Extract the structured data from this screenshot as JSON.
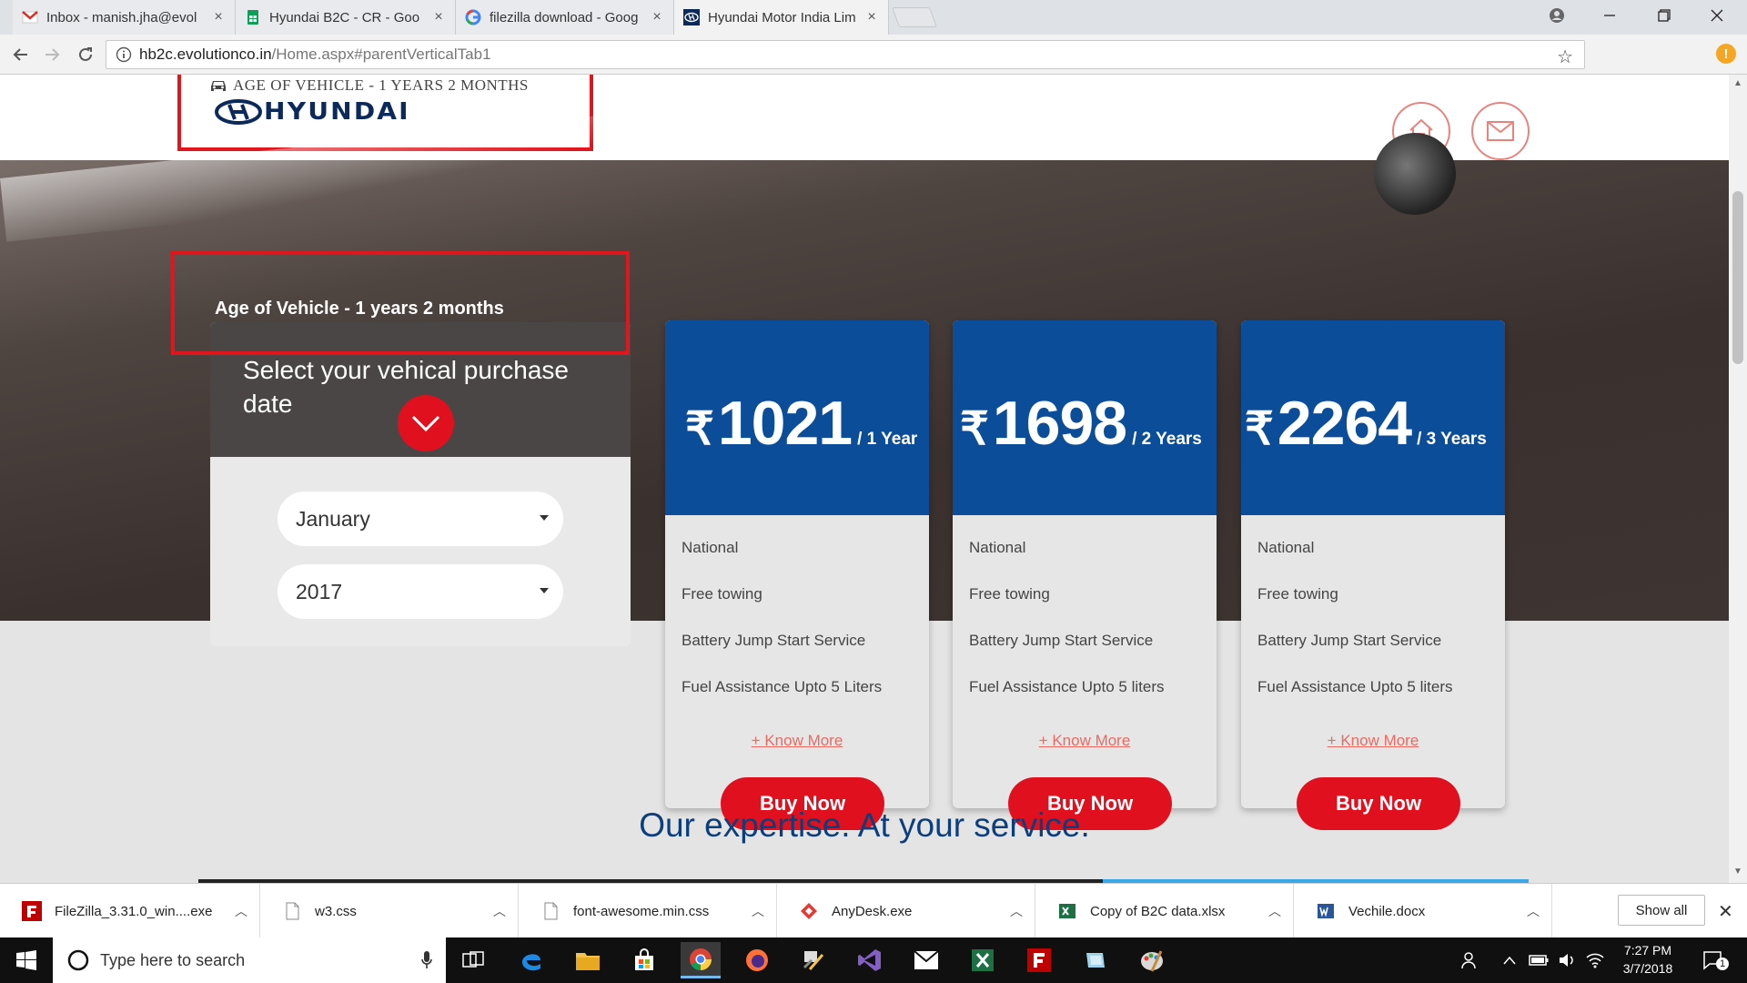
{
  "browser": {
    "tabs": [
      {
        "label": "Inbox - manish.jha@evol",
        "icon": "gmail-icon"
      },
      {
        "label": "Hyundai B2C - CR - Goo",
        "icon": "sheets-icon"
      },
      {
        "label": "filezilla download - Goog",
        "icon": "google-icon"
      },
      {
        "label": "Hyundai Motor India Lim",
        "icon": "hyundai-icon"
      }
    ],
    "close_glyph": "×",
    "url_host": "hb2c.evolutionco.in",
    "url_path": "/Home.aspx#parentVerticalTab1",
    "alert_badge": "!"
  },
  "header": {
    "age_banner": "AGE OF VEHICLE - 1 YEARS 2 MONTHS",
    "logo_text": "HYUNDAI"
  },
  "hero": {
    "age_text": "Age of Vehicle - 1 years 2 months",
    "date_panel": {
      "title": "Select your vehical purchase date",
      "month": "January",
      "year": "2017"
    }
  },
  "plans": [
    {
      "price": "1021",
      "period": "/ 1 Year",
      "features": [
        "National",
        "Free towing",
        "Battery Jump Start Service",
        "Fuel Assistance Upto 5 Liters"
      ],
      "know_more": "+ Know More",
      "buy": "Buy Now"
    },
    {
      "price": "1698",
      "period": "/ 2 Years",
      "features": [
        "National",
        "Free towing",
        "Battery Jump Start Service",
        "Fuel Assistance Upto 5 liters"
      ],
      "know_more": "+ Know More",
      "buy": "Buy Now"
    },
    {
      "price": "2264",
      "period": "/ 3 Years",
      "features": [
        "National",
        "Free towing",
        "Battery Jump Start Service",
        "Fuel Assistance Upto 5 liters"
      ],
      "know_more": "+ Know More",
      "buy": "Buy Now"
    }
  ],
  "currency_symbol": "₹",
  "expertise_heading": "Our expertise. At your service.",
  "downloads": {
    "items": [
      {
        "name": "FileZilla_3.31.0_win....exe",
        "icon": "filezilla-icon"
      },
      {
        "name": "w3.css",
        "icon": "file-icon"
      },
      {
        "name": "font-awesome.min.css",
        "icon": "file-icon"
      },
      {
        "name": "AnyDesk.exe",
        "icon": "anydesk-icon"
      },
      {
        "name": "Copy of B2C data.xlsx",
        "icon": "excel-icon"
      },
      {
        "name": "Vechile.docx",
        "icon": "word-icon"
      }
    ],
    "show_all": "Show all"
  },
  "taskbar": {
    "search_placeholder": "Type here to search",
    "time": "7:27 PM",
    "date": "3/7/2018",
    "notification_count": "1"
  },
  "colors": {
    "brand_red": "#e0101f",
    "plan_blue": "#0c4d99",
    "heading_blue": "#0c3e7c",
    "hyundai_navy": "#0b2a5b"
  }
}
